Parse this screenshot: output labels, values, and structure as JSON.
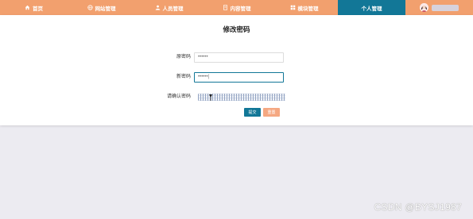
{
  "nav": {
    "items": [
      {
        "label": "首页",
        "icon": "home-icon"
      },
      {
        "label": "网站管理",
        "icon": "globe-icon"
      },
      {
        "label": "人员管理",
        "icon": "person-icon"
      },
      {
        "label": "内容管理",
        "icon": "document-icon"
      },
      {
        "label": "模块管理",
        "icon": "grid-icon"
      },
      {
        "label": "个人管理",
        "icon": "",
        "active": true
      }
    ],
    "user": {
      "name": "",
      "avatar_icon": "avatar-icon"
    }
  },
  "page": {
    "title": "修改密码"
  },
  "form": {
    "old_password_label": "原密码",
    "old_password_value": "••••••",
    "new_password_label": "新密码",
    "new_password_value": "••••••|",
    "confirm_password_label": "请确认密码",
    "confirm_password_value": ""
  },
  "buttons": {
    "submit": "提交",
    "reset": "重置"
  },
  "watermark": "CSDN @BYSJ1987",
  "colors": {
    "nav_bg": "#f2a06e",
    "nav_active": "#127797",
    "submit": "#127797",
    "reset": "#f5a882",
    "page_bg": "#ecebf1"
  }
}
